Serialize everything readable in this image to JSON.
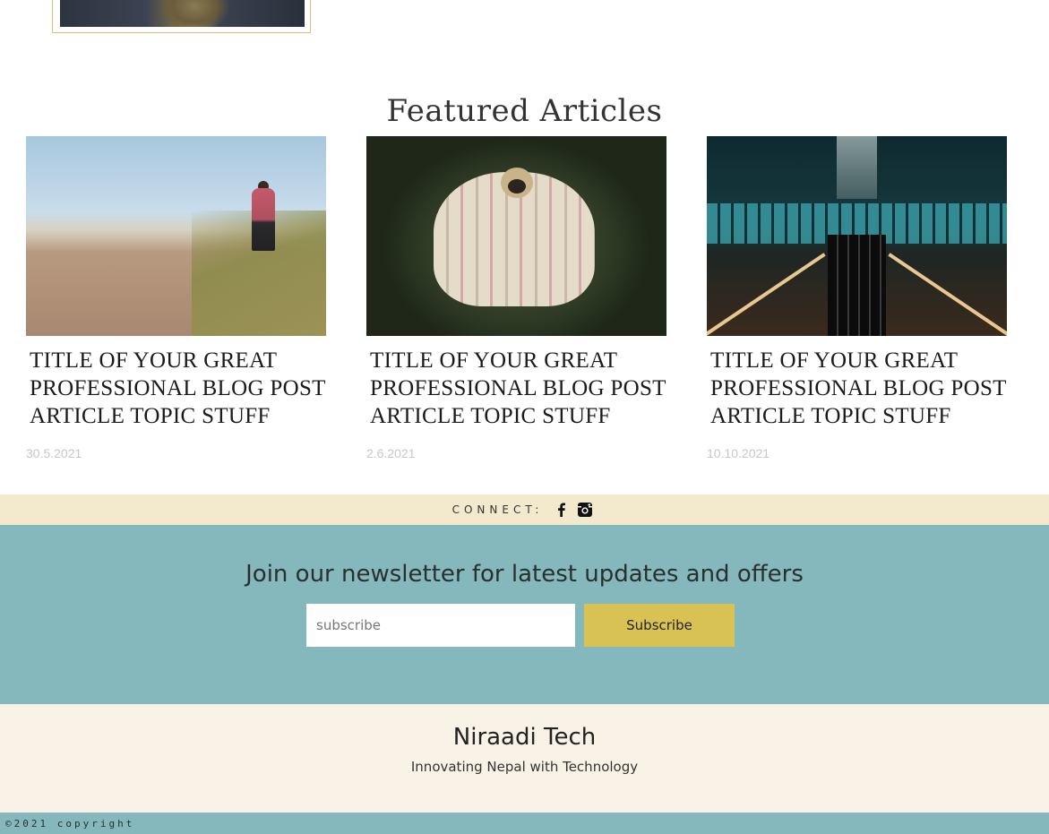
{
  "featured": {
    "heading": "Featured Articles",
    "articles": [
      {
        "title": "TITLE OF YOUR GREAT PROFESSIONAL BLOG POST ARTICLE TOPIC STUFF",
        "date": "30.5.2021"
      },
      {
        "title": "TITLE OF YOUR GREAT PROFESSIONAL BLOG POST ARTICLE TOPIC STUFF",
        "date": "2.6.2021"
      },
      {
        "title": "TITLE OF YOUR GREAT PROFESSIONAL BLOG POST ARTICLE TOPIC STUFF",
        "date": "10.10.2021"
      }
    ]
  },
  "connect": {
    "label": "CONNECT:",
    "icons": [
      "facebook-icon",
      "instagram-icon"
    ]
  },
  "newsletter": {
    "title": "Join our newsletter for latest updates and offers",
    "placeholder": "subscribe",
    "button_label": "Subscribe"
  },
  "footer": {
    "brand": "Niraadi Tech",
    "tagline": "Innovating Nepal with Technology",
    "copyright": "©2021 copyright"
  },
  "colors": {
    "connect_bar": "#f3e9cc",
    "newsletter_bg": "#84b8bc",
    "button": "#d9c254",
    "footer_bg": "#f8f3e6"
  }
}
